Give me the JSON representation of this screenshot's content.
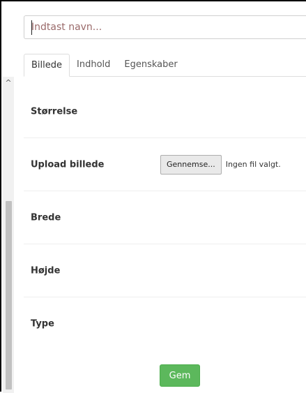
{
  "header": {
    "name_placeholder": "Indtast navn..."
  },
  "tabs": [
    {
      "label": "Billede",
      "active": true
    },
    {
      "label": "Indhold",
      "active": false
    },
    {
      "label": "Egenskaber",
      "active": false
    }
  ],
  "form": {
    "size_label": "Størrelse",
    "upload_label": "Upload billede",
    "browse_label": "Gennemse...",
    "file_status": "Ingen fil valgt.",
    "width_label": "Brede",
    "height_label": "Højde",
    "type_label": "Type"
  },
  "actions": {
    "save_label": "Gem"
  },
  "colors": {
    "save_button": "#5cb85c",
    "scroll_thumb": "#c1c1c1"
  }
}
